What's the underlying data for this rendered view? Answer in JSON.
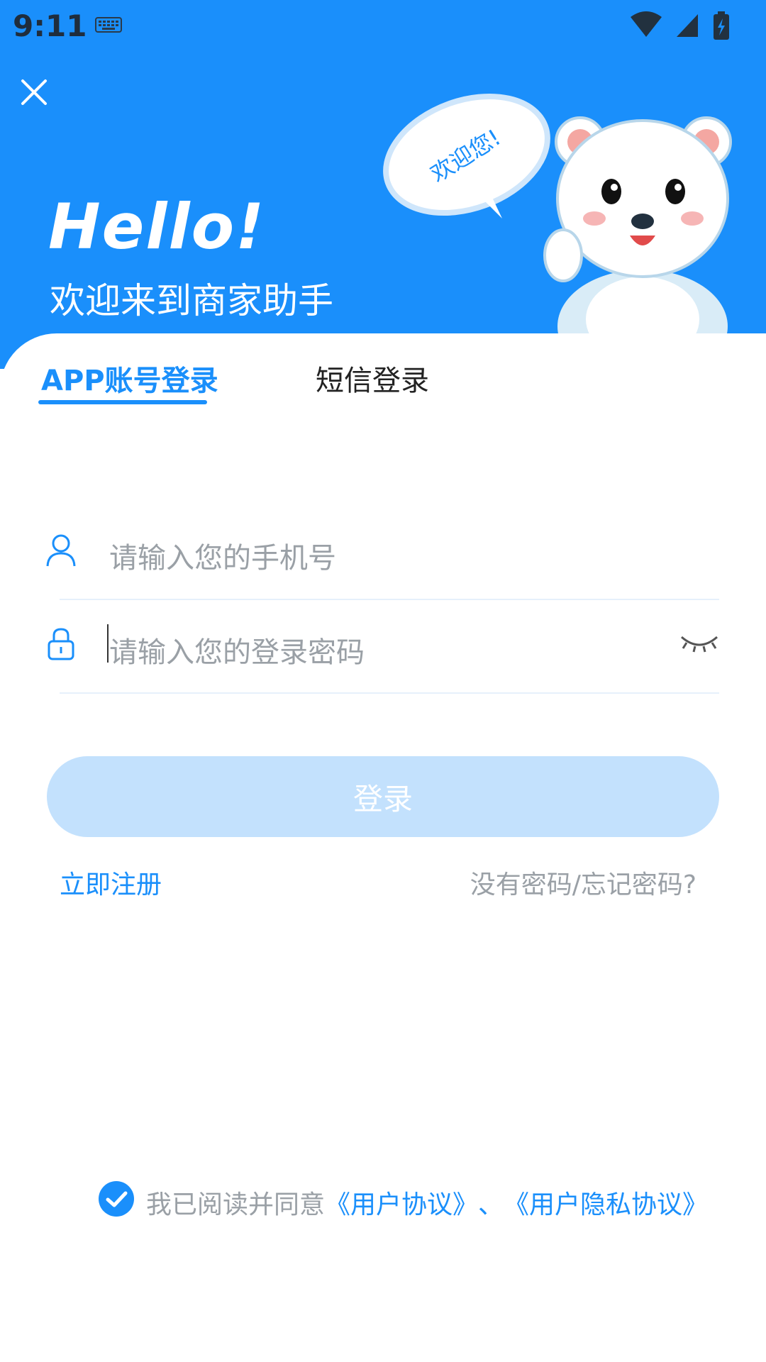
{
  "status_bar": {
    "time": "9:11"
  },
  "header": {
    "hello": "Hello!",
    "welcome": "欢迎来到商家助手",
    "bubble_text": "欢迎您!"
  },
  "tabs": [
    {
      "label": "APP账号登录",
      "active": true
    },
    {
      "label": "短信登录",
      "active": false
    }
  ],
  "form": {
    "phone_placeholder": "请输入您的手机号",
    "password_placeholder": "请输入您的登录密码",
    "login_label": "登录"
  },
  "links": {
    "register": "立即注册",
    "forgot": "没有密码/忘记密码?"
  },
  "agreement": {
    "prefix": "我已阅读并同意",
    "user_agreement": "《用户协议》",
    "separator": "、",
    "privacy_agreement": "《用户隐私协议》",
    "checked": true
  },
  "colors": {
    "accent": "#1a8ffb",
    "button_disabled": "#c3e1fd",
    "placeholder": "#9aa0a6"
  },
  "icons": [
    "keyboard-icon",
    "wifi-icon",
    "signal-icon",
    "battery-icon",
    "close-icon",
    "user-icon",
    "lock-icon",
    "eye-closed-icon",
    "check-icon"
  ]
}
